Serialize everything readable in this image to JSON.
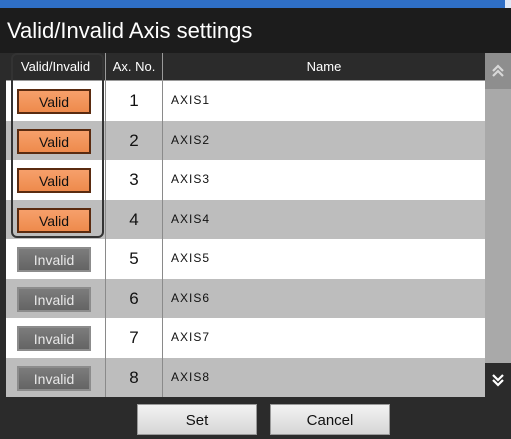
{
  "title": "Valid/Invalid Axis settings",
  "headers": {
    "valid": "Valid/Invalid",
    "axno": "Ax. No.",
    "name": "Name"
  },
  "rows": [
    {
      "state": "Valid",
      "axno": "1",
      "name": "AXIS1"
    },
    {
      "state": "Valid",
      "axno": "2",
      "name": "AXIS2"
    },
    {
      "state": "Valid",
      "axno": "3",
      "name": "AXIS3"
    },
    {
      "state": "Valid",
      "axno": "4",
      "name": "AXIS4"
    },
    {
      "state": "Invalid",
      "axno": "5",
      "name": "AXIS5"
    },
    {
      "state": "Invalid",
      "axno": "6",
      "name": "AXIS6"
    },
    {
      "state": "Invalid",
      "axno": "7",
      "name": "AXIS7"
    },
    {
      "state": "Invalid",
      "axno": "8",
      "name": "AXIS8"
    }
  ],
  "scroll": {
    "up_icon": "chevron-double-up-icon",
    "down_icon": "chevron-double-down-icon"
  },
  "footer": {
    "set_label": "Set",
    "cancel_label": "Cancel"
  },
  "colors": {
    "valid_button": "#ee8a4c",
    "invalid_button": "#6e6e6e",
    "title_bar": "#2f6fc6"
  }
}
